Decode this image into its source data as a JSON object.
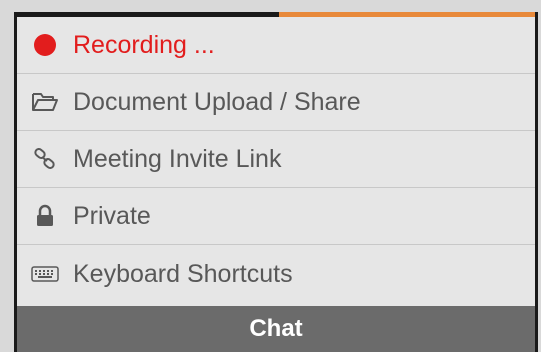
{
  "menu": {
    "items": [
      {
        "label": "Recording ...",
        "icon": "record-dot-icon"
      },
      {
        "label": "Document Upload / Share",
        "icon": "folder-open-icon"
      },
      {
        "label": "Meeting Invite Link",
        "icon": "link-icon"
      },
      {
        "label": "Private",
        "icon": "lock-icon"
      },
      {
        "label": "Keyboard Shortcuts",
        "icon": "keyboard-icon"
      }
    ]
  },
  "chat": {
    "label": "Chat"
  },
  "colors": {
    "recording": "#e21d1d",
    "progress": "#e8893a",
    "chat_bar": "#6b6b6b",
    "menu_bg": "#e6e6e6",
    "text": "#585858"
  }
}
